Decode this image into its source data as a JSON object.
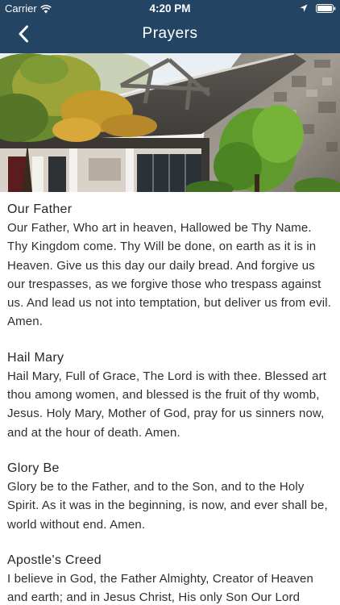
{
  "status_bar": {
    "carrier": "Carrier",
    "time": "4:20 PM",
    "icons": [
      "wifi-icon",
      "location-icon",
      "battery-icon"
    ]
  },
  "nav": {
    "title": "Prayers",
    "back_icon": "chevron-left-icon"
  },
  "colors": {
    "header_bg": "#244463",
    "header_text": "#ffffff",
    "body_text": "#2e2e2e"
  },
  "hero": {
    "image": "church-building-photo"
  },
  "prayers": [
    {
      "title": "Our Father",
      "text": "Our Father, Who art in heaven, Hallowed be Thy Name. Thy Kingdom come. Thy Will be done, on earth as it is in Heaven. Give us this day our daily bread. And forgive us our trespasses, as we forgive those who trespass against us. And lead us not into temptation, but deliver us from evil. Amen."
    },
    {
      "title": "Hail Mary",
      "text": "Hail Mary, Full of Grace, The Lord is with thee. Blessed art thou among women, and blessed is the fruit of thy womb, Jesus. Holy Mary, Mother of God, pray for us sinners now, and at the hour of death. Amen."
    },
    {
      "title": "Glory Be",
      "text": "Glory be to the Father, and to the Son, and to the Holy Spirit. As it was in the beginning, is now, and ever shall be, world without end. Amen."
    },
    {
      "title": "Apostle's Creed",
      "text": "I believe in God, the Father Almighty, Creator of Heaven and earth; and in Jesus Christ, His only Son Our Lord"
    }
  ]
}
